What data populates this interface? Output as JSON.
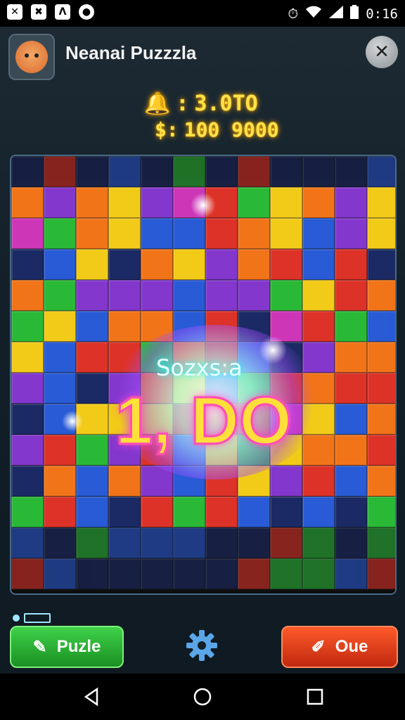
{
  "status_bar": {
    "time": "0:16",
    "left_icons": [
      "x-icon",
      "alert-icon",
      "lambda-icon",
      "record-icon"
    ],
    "right_icons": [
      "alarm-icon",
      "wifi-icon",
      "signal-icon",
      "battery-icon"
    ]
  },
  "header": {
    "title": "Neanai Puzzzla",
    "close_label": "✕"
  },
  "stats": {
    "score_icon": "bell-icon",
    "score_prefix": ":",
    "score_value": "3.0TO",
    "coins_prefix": "$:",
    "coins_value": "100 9000"
  },
  "combo": {
    "label": "Sozxs:a",
    "value": "1, DO"
  },
  "buttons": {
    "puzzle_label": "Puzle",
    "other_label": "Oue"
  },
  "colors": {
    "red": "#e8342a",
    "orange": "#ff7a1a",
    "yellow": "#ffd51a",
    "green": "#2cc23a",
    "blue": "#2a5fe0",
    "purple": "#8a3ad8",
    "magenta": "#d83ac0",
    "navy": "#1c2c6a"
  }
}
